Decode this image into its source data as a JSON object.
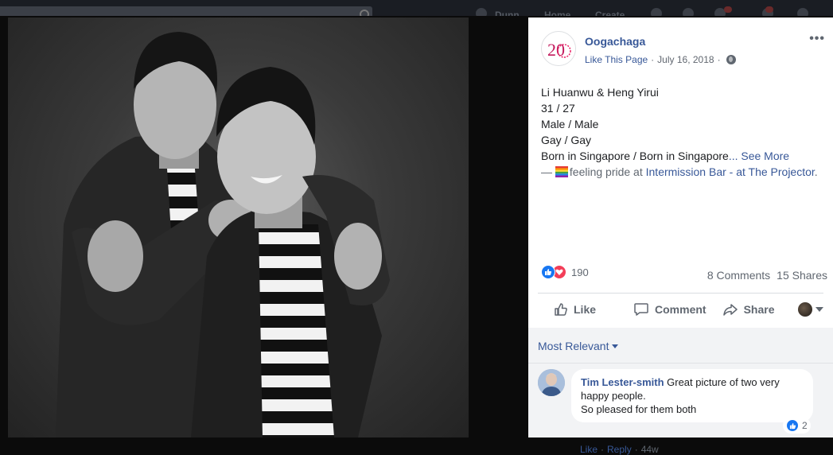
{
  "topbar": {
    "nav_items": [
      "Dunn",
      "Home",
      "Create"
    ]
  },
  "post": {
    "page_name": "Oogachaga",
    "like_page": "Like This Page",
    "date": "July 16, 2018",
    "privacy_icon": "globe-icon",
    "more_icon": "ellipsis-icon",
    "logo_text": "20",
    "lines": [
      "Li Huanwu & Heng Yirui",
      "31 / 27",
      "Male / Male",
      "Gay / Gay"
    ],
    "born_line": "Born in Singapore / Born in Singapore",
    "see_more": "... See More",
    "dash": "— ",
    "feeling": "feeling pride at ",
    "place_link": "Intermission Bar - at The Projector",
    "end_period": "."
  },
  "stats": {
    "reaction_count": "190",
    "comments": "8 Comments",
    "shares": "15 Shares"
  },
  "actions": {
    "like": "Like",
    "comment": "Comment",
    "share": "Share"
  },
  "comments": {
    "sort_label": "Most Relevant",
    "items": [
      {
        "author": "Tim Lester-smith",
        "text_line1": " Great picture of two very",
        "text_line2": "happy people.",
        "text_line3": "So pleased for them both",
        "reaction_count": "2",
        "like": "Like",
        "reply": "Reply",
        "time": "44w"
      }
    ]
  },
  "colors": {
    "link": "#385898",
    "like_blue": "#1877f2",
    "love_red": "#f33e58",
    "muted": "#606770"
  }
}
